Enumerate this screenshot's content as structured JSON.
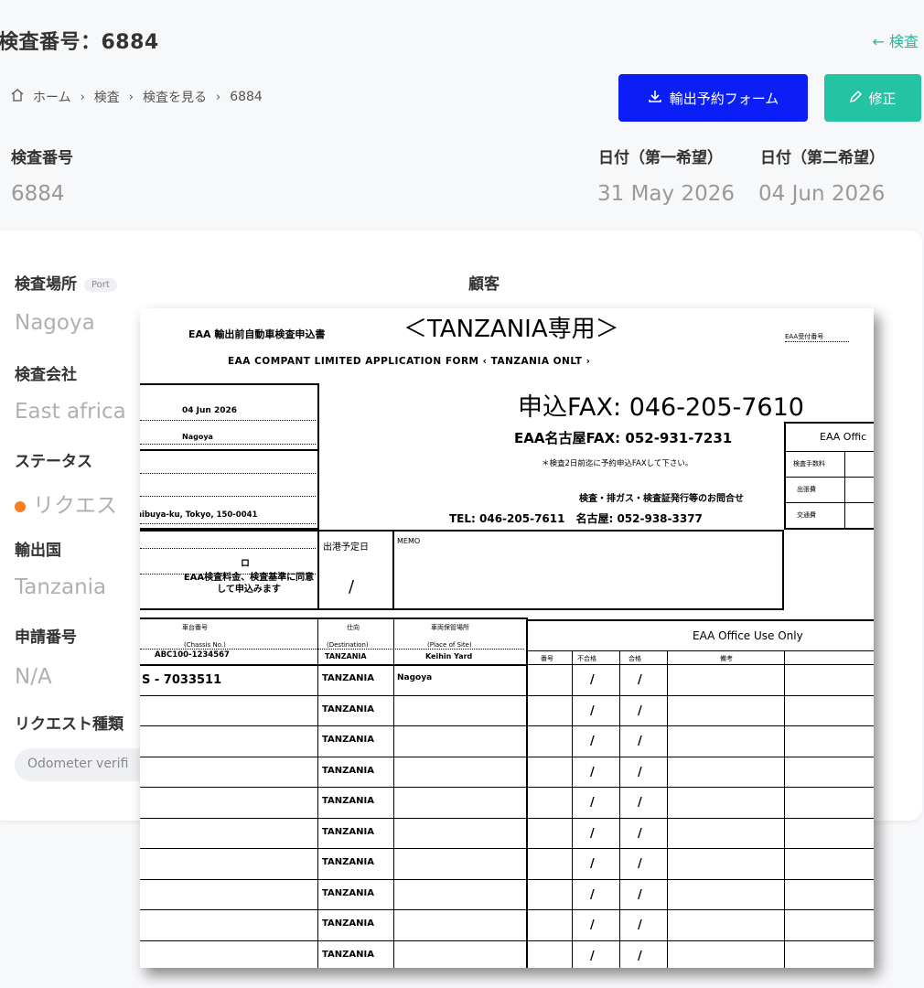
{
  "header": {
    "title": "検査番号：6884",
    "back_label": "← 検査",
    "breadcrumb": [
      "ホーム",
      "検査",
      "検査を見る",
      "6884"
    ],
    "export_button": "輸出予約フォーム",
    "edit_button": "修正",
    "inspection_number_label": "検査番号",
    "inspection_number_value": "6884",
    "date1_label": "日付（第一希望）",
    "date1_value": "31 May 2026",
    "date2_label": "日付（第二希望）",
    "date2_value": "04 Jun 2026"
  },
  "details": {
    "location_label": "検査場所",
    "location_pill": "Port",
    "location_value": "Nagoya",
    "customer_label": "顧客",
    "company_label": "検査会社",
    "company_value": "East africa",
    "status_label": "ステータス",
    "status_value": "リクエス",
    "status_color": "#f77f22",
    "export_country_label": "輸出国",
    "export_country_value": "Tanzania",
    "application_number_label": "申請番号",
    "application_number_value": "N/A",
    "request_type_label": "リクエスト種類",
    "request_type_value": "Odometer verifi"
  },
  "document": {
    "company_small": "EAA 輸出前自動車検査申込書",
    "title_big": "＜TANZANIA専用＞",
    "corner_label": "EAA受付番号",
    "subtitle": "EAA COMPANT LIMITED APPLICATION FORM ‹ TANZANIA ONLT ›",
    "date_value": "04 Jun 2026",
    "place_value": "Nagoya",
    "address_value": "hibuya-ku, Tokyo, 150-0041",
    "fax_main": "申込FAX: 046-205-7610",
    "fax_nagoya": "EAA名古屋FAX: 052-931-7231",
    "note": "＊検査2日前迄に予約申込FAXして下さい。",
    "inquiry": "検査・排ガス・検査証発行等のお問合せ",
    "tel": "TEL: 046-205-7611　名古屋: 052-938-3377",
    "office_label_top": "EAA Offic",
    "fee_rows": [
      "検査手数料",
      "出張費",
      "交通費"
    ],
    "ship_date_label": "出港予定日",
    "ship_slash": "/",
    "memo_label": "MEMO",
    "notice_prefix": "ロ",
    "notice": "EAA検査料金、検査基準に同意して申込みます",
    "office_use": "EAA Office Use Only",
    "col_chassis": "車台番号",
    "col_chassis_en": "(Chassis No.)",
    "col_chassis_ex": "ABC100-1234567",
    "col_dest": "仕向",
    "col_dest_en": "(Destination)",
    "col_dest_ex": "TANZANIA",
    "col_site": "車両保管場所",
    "col_site_en": "(Place of Site)",
    "col_site_ex": "Keihin Yard",
    "col_no": "番号",
    "col_fail": "不合格",
    "col_pass": "合格",
    "col_remark": "備考",
    "rows": [
      {
        "chassis": "S - 7033511",
        "dest": "TANZANIA",
        "site": "Nagoya"
      },
      {
        "chassis": "",
        "dest": "TANZANIA",
        "site": ""
      },
      {
        "chassis": "",
        "dest": "TANZANIA",
        "site": ""
      },
      {
        "chassis": "",
        "dest": "TANZANIA",
        "site": ""
      },
      {
        "chassis": "",
        "dest": "TANZANIA",
        "site": ""
      },
      {
        "chassis": "",
        "dest": "TANZANIA",
        "site": ""
      },
      {
        "chassis": "",
        "dest": "TANZANIA",
        "site": ""
      },
      {
        "chassis": "",
        "dest": "TANZANIA",
        "site": ""
      },
      {
        "chassis": "",
        "dest": "TANZANIA",
        "site": ""
      },
      {
        "chassis": "",
        "dest": "TANZANIA",
        "site": ""
      }
    ],
    "slash": "/"
  },
  "colors": {
    "primary_blue": "#0b1ef5",
    "teal": "#23c3a3"
  }
}
